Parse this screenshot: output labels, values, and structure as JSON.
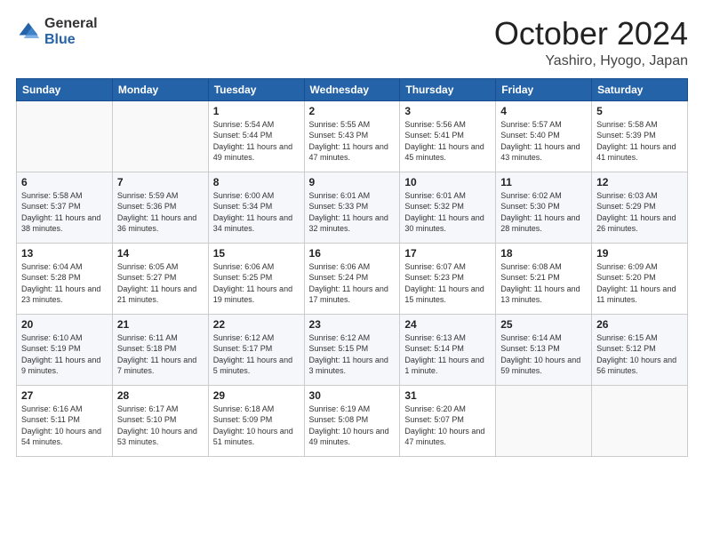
{
  "header": {
    "logo_general": "General",
    "logo_blue": "Blue",
    "month_title": "October 2024",
    "location": "Yashiro, Hyogo, Japan"
  },
  "weekdays": [
    "Sunday",
    "Monday",
    "Tuesday",
    "Wednesday",
    "Thursday",
    "Friday",
    "Saturday"
  ],
  "weeks": [
    [
      {
        "day": "",
        "sunrise": "",
        "sunset": "",
        "daylight": ""
      },
      {
        "day": "",
        "sunrise": "",
        "sunset": "",
        "daylight": ""
      },
      {
        "day": "1",
        "sunrise": "Sunrise: 5:54 AM",
        "sunset": "Sunset: 5:44 PM",
        "daylight": "Daylight: 11 hours and 49 minutes."
      },
      {
        "day": "2",
        "sunrise": "Sunrise: 5:55 AM",
        "sunset": "Sunset: 5:43 PM",
        "daylight": "Daylight: 11 hours and 47 minutes."
      },
      {
        "day": "3",
        "sunrise": "Sunrise: 5:56 AM",
        "sunset": "Sunset: 5:41 PM",
        "daylight": "Daylight: 11 hours and 45 minutes."
      },
      {
        "day": "4",
        "sunrise": "Sunrise: 5:57 AM",
        "sunset": "Sunset: 5:40 PM",
        "daylight": "Daylight: 11 hours and 43 minutes."
      },
      {
        "day": "5",
        "sunrise": "Sunrise: 5:58 AM",
        "sunset": "Sunset: 5:39 PM",
        "daylight": "Daylight: 11 hours and 41 minutes."
      }
    ],
    [
      {
        "day": "6",
        "sunrise": "Sunrise: 5:58 AM",
        "sunset": "Sunset: 5:37 PM",
        "daylight": "Daylight: 11 hours and 38 minutes."
      },
      {
        "day": "7",
        "sunrise": "Sunrise: 5:59 AM",
        "sunset": "Sunset: 5:36 PM",
        "daylight": "Daylight: 11 hours and 36 minutes."
      },
      {
        "day": "8",
        "sunrise": "Sunrise: 6:00 AM",
        "sunset": "Sunset: 5:34 PM",
        "daylight": "Daylight: 11 hours and 34 minutes."
      },
      {
        "day": "9",
        "sunrise": "Sunrise: 6:01 AM",
        "sunset": "Sunset: 5:33 PM",
        "daylight": "Daylight: 11 hours and 32 minutes."
      },
      {
        "day": "10",
        "sunrise": "Sunrise: 6:01 AM",
        "sunset": "Sunset: 5:32 PM",
        "daylight": "Daylight: 11 hours and 30 minutes."
      },
      {
        "day": "11",
        "sunrise": "Sunrise: 6:02 AM",
        "sunset": "Sunset: 5:30 PM",
        "daylight": "Daylight: 11 hours and 28 minutes."
      },
      {
        "day": "12",
        "sunrise": "Sunrise: 6:03 AM",
        "sunset": "Sunset: 5:29 PM",
        "daylight": "Daylight: 11 hours and 26 minutes."
      }
    ],
    [
      {
        "day": "13",
        "sunrise": "Sunrise: 6:04 AM",
        "sunset": "Sunset: 5:28 PM",
        "daylight": "Daylight: 11 hours and 23 minutes."
      },
      {
        "day": "14",
        "sunrise": "Sunrise: 6:05 AM",
        "sunset": "Sunset: 5:27 PM",
        "daylight": "Daylight: 11 hours and 21 minutes."
      },
      {
        "day": "15",
        "sunrise": "Sunrise: 6:06 AM",
        "sunset": "Sunset: 5:25 PM",
        "daylight": "Daylight: 11 hours and 19 minutes."
      },
      {
        "day": "16",
        "sunrise": "Sunrise: 6:06 AM",
        "sunset": "Sunset: 5:24 PM",
        "daylight": "Daylight: 11 hours and 17 minutes."
      },
      {
        "day": "17",
        "sunrise": "Sunrise: 6:07 AM",
        "sunset": "Sunset: 5:23 PM",
        "daylight": "Daylight: 11 hours and 15 minutes."
      },
      {
        "day": "18",
        "sunrise": "Sunrise: 6:08 AM",
        "sunset": "Sunset: 5:21 PM",
        "daylight": "Daylight: 11 hours and 13 minutes."
      },
      {
        "day": "19",
        "sunrise": "Sunrise: 6:09 AM",
        "sunset": "Sunset: 5:20 PM",
        "daylight": "Daylight: 11 hours and 11 minutes."
      }
    ],
    [
      {
        "day": "20",
        "sunrise": "Sunrise: 6:10 AM",
        "sunset": "Sunset: 5:19 PM",
        "daylight": "Daylight: 11 hours and 9 minutes."
      },
      {
        "day": "21",
        "sunrise": "Sunrise: 6:11 AM",
        "sunset": "Sunset: 5:18 PM",
        "daylight": "Daylight: 11 hours and 7 minutes."
      },
      {
        "day": "22",
        "sunrise": "Sunrise: 6:12 AM",
        "sunset": "Sunset: 5:17 PM",
        "daylight": "Daylight: 11 hours and 5 minutes."
      },
      {
        "day": "23",
        "sunrise": "Sunrise: 6:12 AM",
        "sunset": "Sunset: 5:15 PM",
        "daylight": "Daylight: 11 hours and 3 minutes."
      },
      {
        "day": "24",
        "sunrise": "Sunrise: 6:13 AM",
        "sunset": "Sunset: 5:14 PM",
        "daylight": "Daylight: 11 hours and 1 minute."
      },
      {
        "day": "25",
        "sunrise": "Sunrise: 6:14 AM",
        "sunset": "Sunset: 5:13 PM",
        "daylight": "Daylight: 10 hours and 59 minutes."
      },
      {
        "day": "26",
        "sunrise": "Sunrise: 6:15 AM",
        "sunset": "Sunset: 5:12 PM",
        "daylight": "Daylight: 10 hours and 56 minutes."
      }
    ],
    [
      {
        "day": "27",
        "sunrise": "Sunrise: 6:16 AM",
        "sunset": "Sunset: 5:11 PM",
        "daylight": "Daylight: 10 hours and 54 minutes."
      },
      {
        "day": "28",
        "sunrise": "Sunrise: 6:17 AM",
        "sunset": "Sunset: 5:10 PM",
        "daylight": "Daylight: 10 hours and 53 minutes."
      },
      {
        "day": "29",
        "sunrise": "Sunrise: 6:18 AM",
        "sunset": "Sunset: 5:09 PM",
        "daylight": "Daylight: 10 hours and 51 minutes."
      },
      {
        "day": "30",
        "sunrise": "Sunrise: 6:19 AM",
        "sunset": "Sunset: 5:08 PM",
        "daylight": "Daylight: 10 hours and 49 minutes."
      },
      {
        "day": "31",
        "sunrise": "Sunrise: 6:20 AM",
        "sunset": "Sunset: 5:07 PM",
        "daylight": "Daylight: 10 hours and 47 minutes."
      },
      {
        "day": "",
        "sunrise": "",
        "sunset": "",
        "daylight": ""
      },
      {
        "day": "",
        "sunrise": "",
        "sunset": "",
        "daylight": ""
      }
    ]
  ]
}
